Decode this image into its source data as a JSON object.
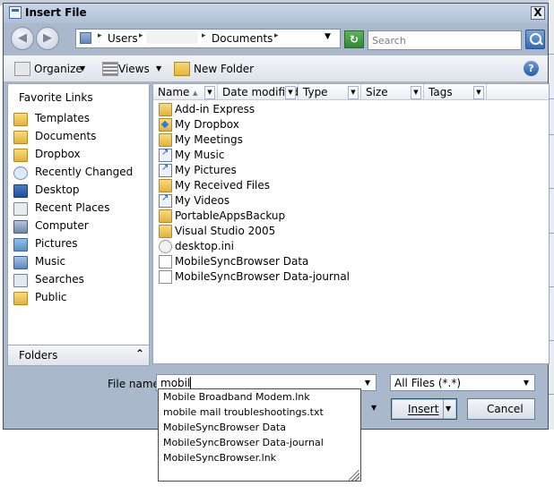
{
  "window": {
    "title": "Insert File",
    "close_glyph": "X"
  },
  "address": {
    "crumbs": [
      "Users",
      "Documents"
    ],
    "separator": "▸",
    "search_placeholder": "Search"
  },
  "toolbar": {
    "organize": "Organize",
    "views": "Views",
    "new_folder": "New Folder",
    "help": "?"
  },
  "favorites": {
    "header": "Favorite Links",
    "items": [
      {
        "label": "Templates",
        "icon": "folder-icon"
      },
      {
        "label": "Documents",
        "icon": "folder-icon"
      },
      {
        "label": "Dropbox",
        "icon": "dropbox-icon"
      },
      {
        "label": "Recently Changed",
        "icon": "recent-icon"
      },
      {
        "label": "Desktop",
        "icon": "desktop-icon"
      },
      {
        "label": "Recent Places",
        "icon": "recent-places-icon"
      },
      {
        "label": "Computer",
        "icon": "computer-icon"
      },
      {
        "label": "Pictures",
        "icon": "pictures-icon"
      },
      {
        "label": "Music",
        "icon": "music-icon"
      },
      {
        "label": "Searches",
        "icon": "searches-icon"
      },
      {
        "label": "Public",
        "icon": "folder-icon"
      }
    ],
    "folders_label": "Folders",
    "folders_chevron": "⌃"
  },
  "columns": [
    "Name",
    "Date modified",
    "Type",
    "Size",
    "Tags"
  ],
  "files": [
    {
      "name": "Add-in Express",
      "icon": "folder-icon"
    },
    {
      "name": "My Dropbox",
      "icon": "dropbox-folder-icon"
    },
    {
      "name": "My Meetings",
      "icon": "folder-icon"
    },
    {
      "name": "My Music",
      "icon": "shortcut-icon"
    },
    {
      "name": "My Pictures",
      "icon": "shortcut-icon"
    },
    {
      "name": "My Received Files",
      "icon": "folder-icon"
    },
    {
      "name": "My Videos",
      "icon": "shortcut-icon"
    },
    {
      "name": "PortableAppsBackup",
      "icon": "folder-icon"
    },
    {
      "name": "Visual Studio 2005",
      "icon": "folder-icon"
    },
    {
      "name": "desktop.ini",
      "icon": "settings-file-icon"
    },
    {
      "name": "MobileSyncBrowser Data",
      "icon": "document-icon"
    },
    {
      "name": "MobileSyncBrowser Data-journal",
      "icon": "document-icon"
    }
  ],
  "filename": {
    "label": "File name:",
    "value": "mobil"
  },
  "filter": {
    "value": "All Files (*.*)"
  },
  "buttons": {
    "insert": "Insert",
    "cancel": "Cancel"
  },
  "autocomplete": [
    "Mobile Broadband Modem.lnk",
    "mobile mail troubleshootings.txt",
    "MobileSyncBrowser Data",
    "MobileSyncBrowser Data-journal",
    "MobileSyncBrowser.lnk"
  ],
  "colors": {
    "accent": "#3469b1",
    "frame": "#aab8cb"
  }
}
